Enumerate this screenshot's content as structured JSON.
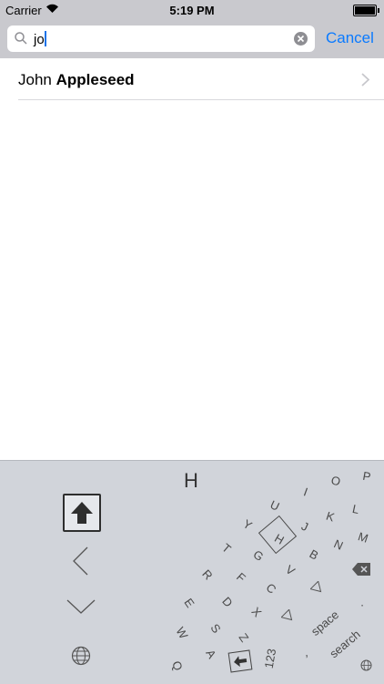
{
  "status_bar": {
    "carrier": "Carrier",
    "time": "5:19 PM"
  },
  "search": {
    "query": "jo",
    "cancel_label": "Cancel"
  },
  "results": [
    {
      "prefix": "John ",
      "bold": "Appleseed"
    }
  ],
  "keyboard": {
    "current_letter": "H",
    "keys": {
      "q": "Q",
      "w": "W",
      "e": "E",
      "r": "R",
      "t": "T",
      "y": "Y",
      "u": "U",
      "i": "I",
      "o": "O",
      "p": "P",
      "a": "A",
      "s": "S",
      "d": "D",
      "f": "F",
      "g": "G",
      "h": "H",
      "j": "J",
      "k": "K",
      "l": "L",
      "z": "Z",
      "x": "X",
      "c": "C",
      "v": "V",
      "b": "B",
      "n": "N",
      "m": "M",
      "num": "123",
      "comma": ",",
      "period": ".",
      "space": "space",
      "search": "search"
    }
  },
  "colors": {
    "accent": "#0a7aff",
    "keyboard_bg": "#d1d4da",
    "bar_bg": "#c9c9ce"
  }
}
